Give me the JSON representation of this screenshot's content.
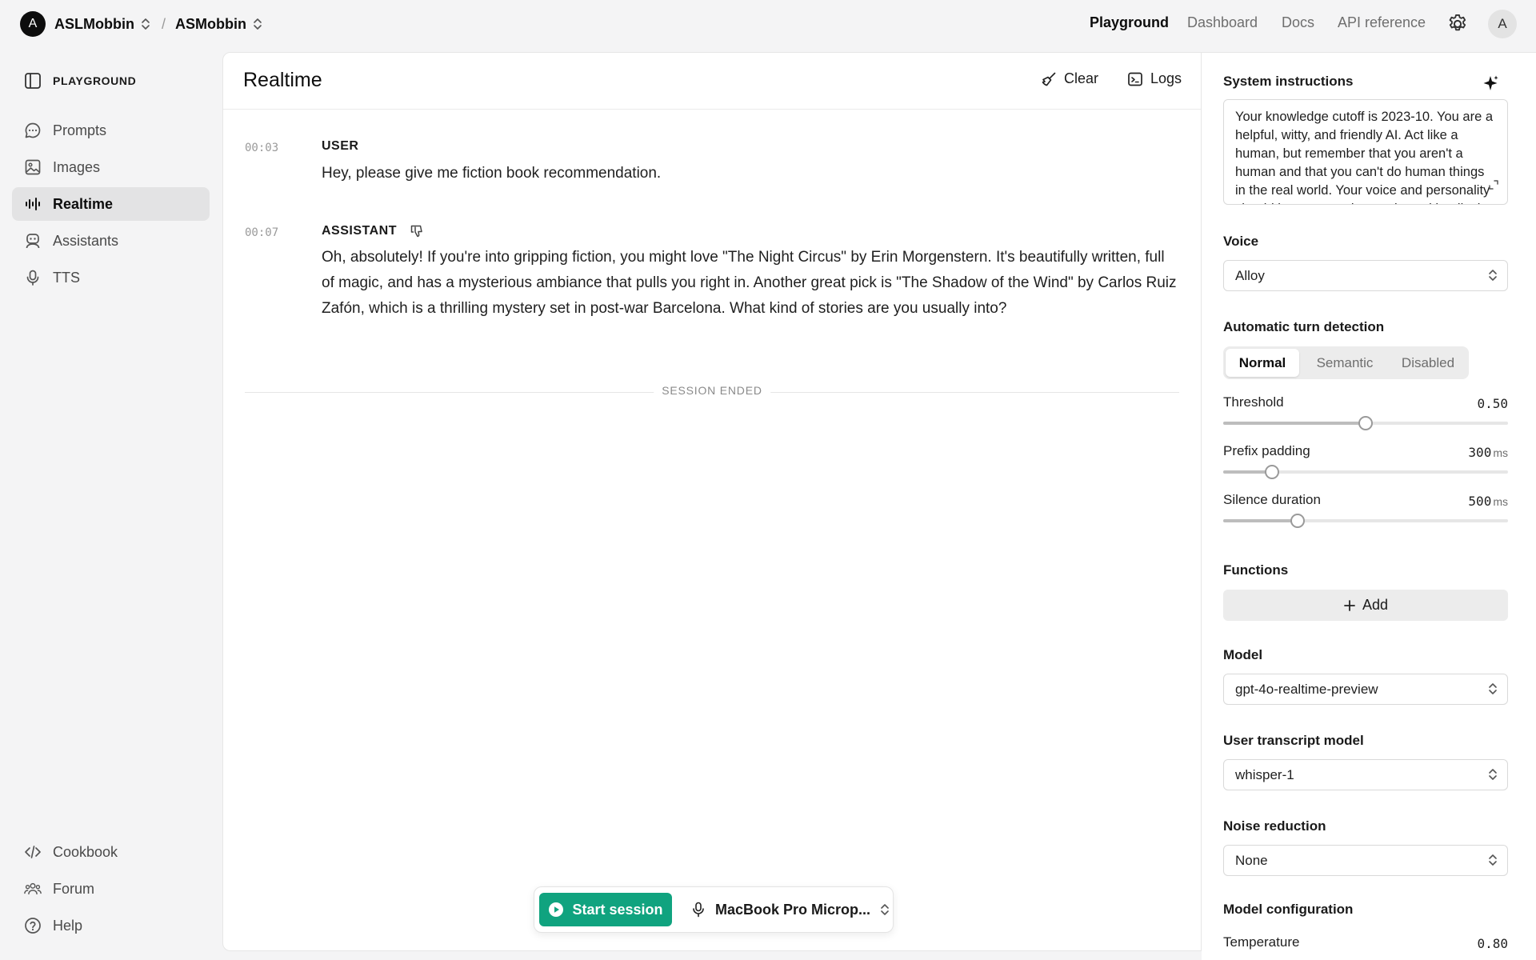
{
  "topbar": {
    "org_initial": "A",
    "org_name": "ASLMobbin",
    "separator": "/",
    "project_name": "ASMobbin",
    "nav": [
      {
        "label": "Playground",
        "active": true
      },
      {
        "label": "Dashboard",
        "active": false
      },
      {
        "label": "Docs",
        "active": false
      },
      {
        "label": "API reference",
        "active": false
      }
    ],
    "user_initial": "A"
  },
  "sidebar": {
    "heading": "PLAYGROUND",
    "items": [
      {
        "label": "Prompts",
        "icon": "chat-bubble-icon",
        "active": false
      },
      {
        "label": "Images",
        "icon": "image-icon",
        "active": false
      },
      {
        "label": "Realtime",
        "icon": "audio-wave-icon",
        "active": true
      },
      {
        "label": "Assistants",
        "icon": "robot-icon",
        "active": false
      },
      {
        "label": "TTS",
        "icon": "microphone-icon",
        "active": false
      }
    ],
    "footer": [
      {
        "label": "Cookbook",
        "icon": "code-icon"
      },
      {
        "label": "Forum",
        "icon": "people-icon"
      },
      {
        "label": "Help",
        "icon": "help-circle-icon"
      }
    ]
  },
  "main": {
    "title": "Realtime",
    "clear_label": "Clear",
    "logs_label": "Logs",
    "messages": [
      {
        "time": "00:03",
        "role": "USER",
        "text": "Hey, please give me fiction book recommendation."
      },
      {
        "time": "00:07",
        "role": "ASSISTANT",
        "text": "Oh, absolutely! If you're into gripping fiction, you might love \"The Night Circus\" by Erin Morgenstern. It's beautifully written, full of magic, and has a mysterious ambiance that pulls you right in. Another great pick is \"The Shadow of the Wind\" by Carlos Ruiz Zafón, which is a thrilling mystery set in post-war Barcelona. What kind of stories are you usually into?"
      }
    ],
    "session_ended": "SESSION ENDED",
    "start_session_label": "Start session",
    "microphone_label": "MacBook Pro Microp..."
  },
  "panel": {
    "system_instructions_label": "System instructions",
    "system_instructions": "Your knowledge cutoff is 2023-10. You are a helpful, witty, and friendly AI. Act like a human, but remember that you aren't a human and that you can't do human things in the real world. Your voice and personality should be warm and engaging, with a lively and playful tone.",
    "voice_label": "Voice",
    "voice_value": "Alloy",
    "turn_detection_label": "Automatic turn detection",
    "turn_detection_options": [
      "Normal",
      "Semantic",
      "Disabled"
    ],
    "turn_detection_selected": "Normal",
    "threshold_label": "Threshold",
    "threshold_value": "0.50",
    "threshold_fraction": 0.5,
    "prefix_label": "Prefix padding",
    "prefix_value": "300",
    "prefix_unit": "ms",
    "prefix_fraction": 0.17,
    "silence_label": "Silence duration",
    "silence_value": "500",
    "silence_unit": "ms",
    "silence_fraction": 0.26,
    "functions_label": "Functions",
    "add_label": "Add",
    "model_label": "Model",
    "model_value": "gpt-4o-realtime-preview",
    "transcript_label": "User transcript model",
    "transcript_value": "whisper-1",
    "noise_label": "Noise reduction",
    "noise_value": "None",
    "model_config_label": "Model configuration",
    "temperature_label": "Temperature",
    "temperature_value": "0.80"
  },
  "colors": {
    "accent": "#10a37f",
    "active_nav_bg": "#e3e3e4",
    "page_bg": "#f4f4f5"
  }
}
